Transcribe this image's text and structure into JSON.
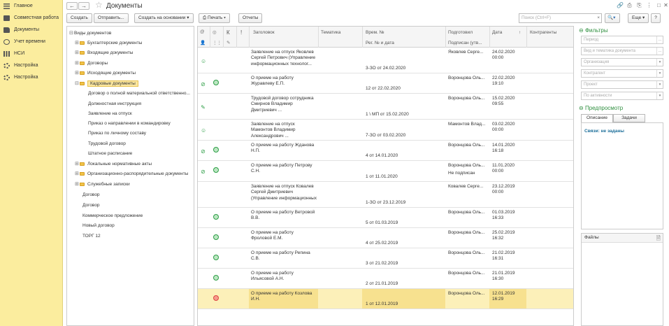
{
  "nav": [
    {
      "label": "Главное",
      "icon": "menu-lines-icon"
    },
    {
      "label": "Совместная работа",
      "icon": "cube-icon"
    },
    {
      "label": "Документы",
      "icon": "folder-icon"
    },
    {
      "label": "Учет времени",
      "icon": "clock-icon"
    },
    {
      "label": "НСИ",
      "icon": "bars-icon"
    },
    {
      "label": "Настройка",
      "icon": "gear-icon"
    },
    {
      "label": "Настройка",
      "icon": "gear-icon"
    }
  ],
  "header": {
    "title": "Документы",
    "back": "←",
    "forward": "→"
  },
  "toolbar": {
    "create": "Создать",
    "send": "Отправить...",
    "create_based": "Создать на основании",
    "print": "Печать",
    "reports": "Отчеты",
    "search_placeholder": "Поиск (Ctrl+F)",
    "search_clear": "×",
    "more": "Еще",
    "help": "?"
  },
  "tree": [
    {
      "label": "Виды документов",
      "level": 0,
      "exp": "⊟",
      "folder": false
    },
    {
      "label": "Бухгалтерские документы",
      "level": 1,
      "exp": "⊞",
      "folder": true
    },
    {
      "label": "Входящие документы",
      "level": 1,
      "exp": "⊞",
      "folder": true
    },
    {
      "label": "Договоры",
      "level": 1,
      "exp": "⊞",
      "folder": true
    },
    {
      "label": "Исходящие документы",
      "level": 1,
      "exp": "⊞",
      "folder": true
    },
    {
      "label": "Кадровые документы",
      "level": 1,
      "exp": "⊟",
      "folder": true,
      "selected": true
    },
    {
      "label": "Договор о полной материальной ответственно...",
      "level": 2,
      "exp": "",
      "folder": false
    },
    {
      "label": "Должностная инструкция",
      "level": 2,
      "exp": "",
      "folder": false
    },
    {
      "label": "Заявление на отпуск",
      "level": 2,
      "exp": "",
      "folder": false
    },
    {
      "label": "Приказ о направлении в командировку",
      "level": 2,
      "exp": "",
      "folder": false
    },
    {
      "label": "Приказ по личному составу",
      "level": 2,
      "exp": "",
      "folder": false
    },
    {
      "label": "Трудовой договор",
      "level": 2,
      "exp": "",
      "folder": false
    },
    {
      "label": "Штатное расписание",
      "level": 2,
      "exp": "",
      "folder": false
    },
    {
      "label": "Локальные нормативные акты",
      "level": 1,
      "exp": "⊞",
      "folder": true
    },
    {
      "label": "Организационно-распорядительные документы",
      "level": 1,
      "exp": "⊞",
      "folder": true
    },
    {
      "label": "Служебные записки",
      "level": 1,
      "exp": "⊞",
      "folder": true
    },
    {
      "label": "Договор",
      "level": 1,
      "exp": "",
      "folder": false
    },
    {
      "label": "Договор",
      "level": 1,
      "exp": "",
      "folder": false
    },
    {
      "label": "Коммерческое предложение",
      "level": 1,
      "exp": "",
      "folder": false
    },
    {
      "label": "Новый договор",
      "level": 1,
      "exp": "",
      "folder": false
    },
    {
      "label": "ТОРГ 12",
      "level": 1,
      "exp": "",
      "folder": false
    }
  ],
  "grid": {
    "headers": {
      "title": "Заголовок",
      "topic": "Тематика",
      "vrem": "Врем. №",
      "reg": "Рег. № и дата",
      "prepared": "Подготовил",
      "signed": "Подписан (утв...",
      "date": "Дата",
      "contractors": "Контрагенты",
      "k": "К",
      "excl": "!",
      "sort": "↑"
    },
    "rows": [
      {
        "title": "Заявление на отпуск Яковлев\nСергей Петрович (Управление\nинформационных технолог...",
        "reg": "3-ЗО от 24.02.2020",
        "prepared": "Яковлев Серге...",
        "signed": "",
        "date": "24.02.2020\n00:00",
        "icon": "user-icon",
        "status": "",
        "h": 37
      },
      {
        "title": "О приеме на работу\nЖуравлеву Е.П.",
        "reg": "12 от 22.02.2020",
        "prepared": "Воронцова Оль...",
        "signed": "",
        "date": "22.02.2020\n19:10",
        "icon": "attach-icon",
        "status": "green",
        "h": 29
      },
      {
        "title": "Трудовой договор сотрудника\nСмирнов Владимир\nДмитриевич ...",
        "reg": "1 \\ МП от 15.02.2020",
        "prepared": "Воронцова Оль...",
        "signed": "",
        "date": "15.02.2020\n09:55",
        "icon": "edit-icon",
        "status": "",
        "h": 37
      },
      {
        "title": "Заявление на отпуск\nМамонтов Владимир\nАлександрович ...",
        "reg": "7-ЗО от 03.02.2020",
        "prepared": "Мамонтов Влад...",
        "signed": "",
        "date": "03.02.2020\n00:00",
        "icon": "user-icon",
        "status": "",
        "h": 30
      },
      {
        "title": "О приеме на работу Жданова\nН.П.",
        "reg": "4 от 14.01.2020",
        "prepared": "Воронцова Оль...",
        "signed": "",
        "date": "14.01.2020\n16:18",
        "icon": "attach-icon",
        "status": "green",
        "h": 29
      },
      {
        "title": "О приеме на работу Петрову\nС.Н.",
        "reg": "1 от 11.01.2020",
        "prepared": "Воронцова Оль...",
        "signed": "Не подписан",
        "date": "11.01.2020\n00:00",
        "icon": "attach-icon",
        "status": "green",
        "h": 30
      },
      {
        "title": "Заявление на отпуск Ковалев\nСергей Дмитриевич\n(Управление информационных",
        "reg": "1-ЗО от 23.12.2019",
        "prepared": "Ковалев Серге...",
        "signed": "",
        "date": "23.12.2019\n00:00",
        "icon": "",
        "status": "",
        "h": 37
      },
      {
        "title": "О приеме на работу Ветровой\nВ.В.",
        "reg": "5 от 01.03.2019",
        "prepared": "Воронцова Оль...",
        "signed": "",
        "date": "01.03.2019\n16:33",
        "icon": "",
        "status": "green",
        "h": 29
      },
      {
        "title": "О приеме на работу\nФроловой Е.М.",
        "reg": "4 от 25.02.2019",
        "prepared": "Воронцова Оль...",
        "signed": "",
        "date": "25.02.2019\n16:32",
        "icon": "",
        "status": "green",
        "h": 29
      },
      {
        "title": "О приеме на работу Репина\nС.В.",
        "reg": "3 от 21.02.2019",
        "prepared": "Воронцова Оль...",
        "signed": "",
        "date": "21.02.2019\n16:31",
        "icon": "",
        "status": "green",
        "h": 29
      },
      {
        "title": "О приеме на работу\nИльясовой А.Н.",
        "reg": "2 от 21.01.2019",
        "prepared": "Воронцова Оль...",
        "signed": "",
        "date": "21.01.2019\n16:30",
        "icon": "",
        "status": "green",
        "h": 29
      },
      {
        "title": "О приеме на работу Козлова\nИ.Н.",
        "reg": "1 от 12.01.2019",
        "prepared": "Воронцова Оль...",
        "signed": "",
        "date": "12.01.2019\n16:29",
        "icon": "",
        "status": "red",
        "h": 29,
        "selected": true
      }
    ]
  },
  "filters": {
    "title": "Фильтры",
    "fields": [
      "Период",
      "Вид и тематика документа",
      "Организация",
      "Контрагент",
      "Проект",
      "По активности"
    ]
  },
  "preview": {
    "title": "Предпросмотр",
    "tab_desc": "Описание",
    "tab_tasks": "Задачи",
    "links": "Связи: не заданы",
    "files": "Файлы"
  }
}
